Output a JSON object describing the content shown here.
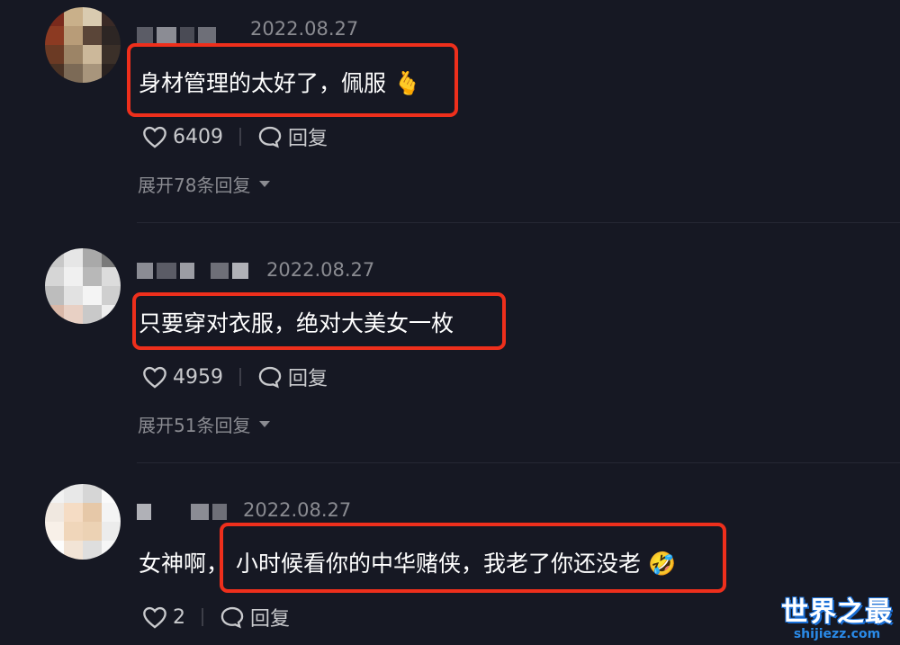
{
  "comments": [
    {
      "date": "2022.08.27",
      "text": "身材管理的太好了，佩服 🫰",
      "likes": "6409",
      "reply_label": "回复",
      "expand_label": "展开78条回复"
    },
    {
      "date": "2022.08.27",
      "text": "只要穿对衣服，绝对大美女一枚",
      "likes": "4959",
      "reply_label": "回复",
      "expand_label": "展开51条回复"
    },
    {
      "date": "2022.08.27",
      "text_prefix": "女神啊，",
      "text": "小时候看你的中华赌侠，我老了你还没老 🤣",
      "likes": "2",
      "reply_label": "回复"
    }
  ],
  "watermark": {
    "logo": "世界之最",
    "url": "shijiezz.com"
  },
  "colors": {
    "background": "#161823",
    "highlight": "#ee2f1c",
    "muted_text": "#8a8b91"
  },
  "icons": [
    "heart-icon",
    "comment-bubble-icon",
    "expand-triangle-icon"
  ]
}
